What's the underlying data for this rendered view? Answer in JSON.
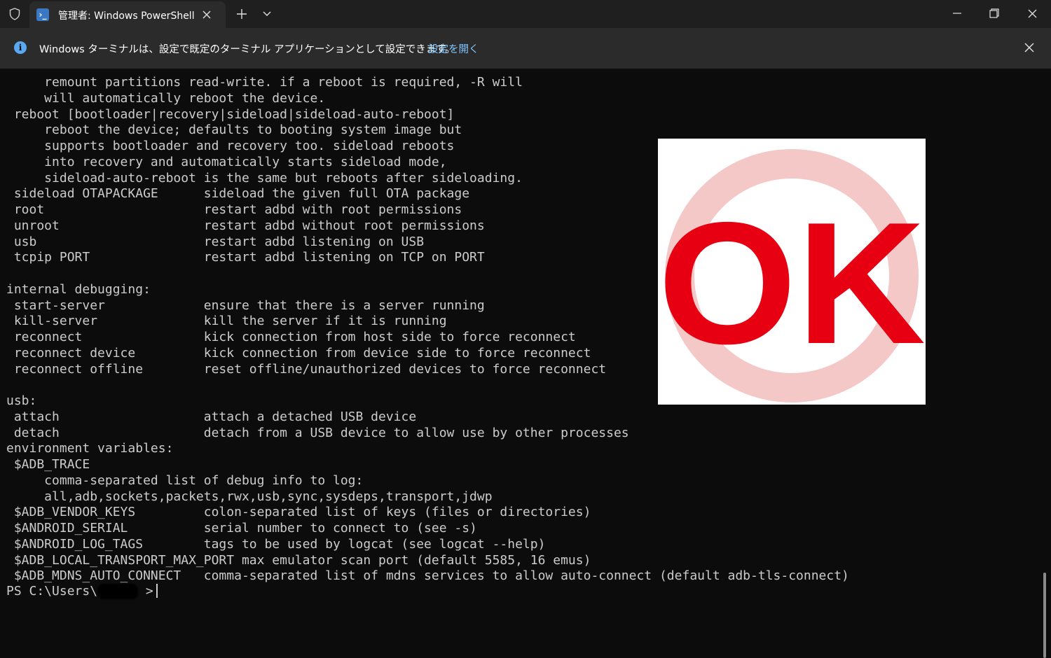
{
  "window": {
    "tab_title": "管理者: Windows PowerShell",
    "tab_icon": "powershell-icon"
  },
  "infobar": {
    "message": "Windows ターミナルは、設定で既定のターミナル アプリケーションとして設定できます。",
    "link": "設定を開く"
  },
  "terminal": {
    "lines": [
      "     remount partitions read-write. if a reboot is required, -R will",
      "     will automatically reboot the device.",
      " reboot [bootloader|recovery|sideload|sideload-auto-reboot]",
      "     reboot the device; defaults to booting system image but",
      "     supports bootloader and recovery too. sideload reboots",
      "     into recovery and automatically starts sideload mode,",
      "     sideload-auto-reboot is the same but reboots after sideloading.",
      " sideload OTAPACKAGE      sideload the given full OTA package",
      " root                     restart adbd with root permissions",
      " unroot                   restart adbd without root permissions",
      " usb                      restart adbd listening on USB",
      " tcpip PORT               restart adbd listening on TCP on PORT",
      "",
      "internal debugging:",
      " start-server             ensure that there is a server running",
      " kill-server              kill the server if it is running",
      " reconnect                kick connection from host side to force reconnect",
      " reconnect device         kick connection from device side to force reconnect",
      " reconnect offline        reset offline/unauthorized devices to force reconnect",
      "",
      "usb:",
      " attach                   attach a detached USB device",
      " detach                   detach from a USB device to allow use by other processes",
      "environment variables:",
      " $ADB_TRACE",
      "     comma-separated list of debug info to log:",
      "     all,adb,sockets,packets,rwx,usb,sync,sysdeps,transport,jdwp",
      " $ADB_VENDOR_KEYS         colon-separated list of keys (files or directories)",
      " $ANDROID_SERIAL          serial number to connect to (see -s)",
      " $ANDROID_LOG_TAGS        tags to be used by logcat (see logcat --help)",
      " $ADB_LOCAL_TRANSPORT_MAX_PORT max emulator scan port (default 5585, 16 emus)",
      " $ADB_MDNS_AUTO_CONNECT   comma-separated list of mdns services to allow auto-connect (default adb-tls-connect)"
    ],
    "prompt_prefix": "PS C:\\Users\\",
    "prompt_suffix": " >"
  },
  "overlay": {
    "text": "OK",
    "text_color": "#e60012",
    "circle_color": "#f5c8c8"
  },
  "colors": {
    "background": "#0c0c0c",
    "foreground": "#cccccc",
    "titlebar": "#1f1f1f",
    "infobar": "#2b2b2b",
    "info_icon": "#5aa9f0",
    "link": "#7fc4ff"
  }
}
